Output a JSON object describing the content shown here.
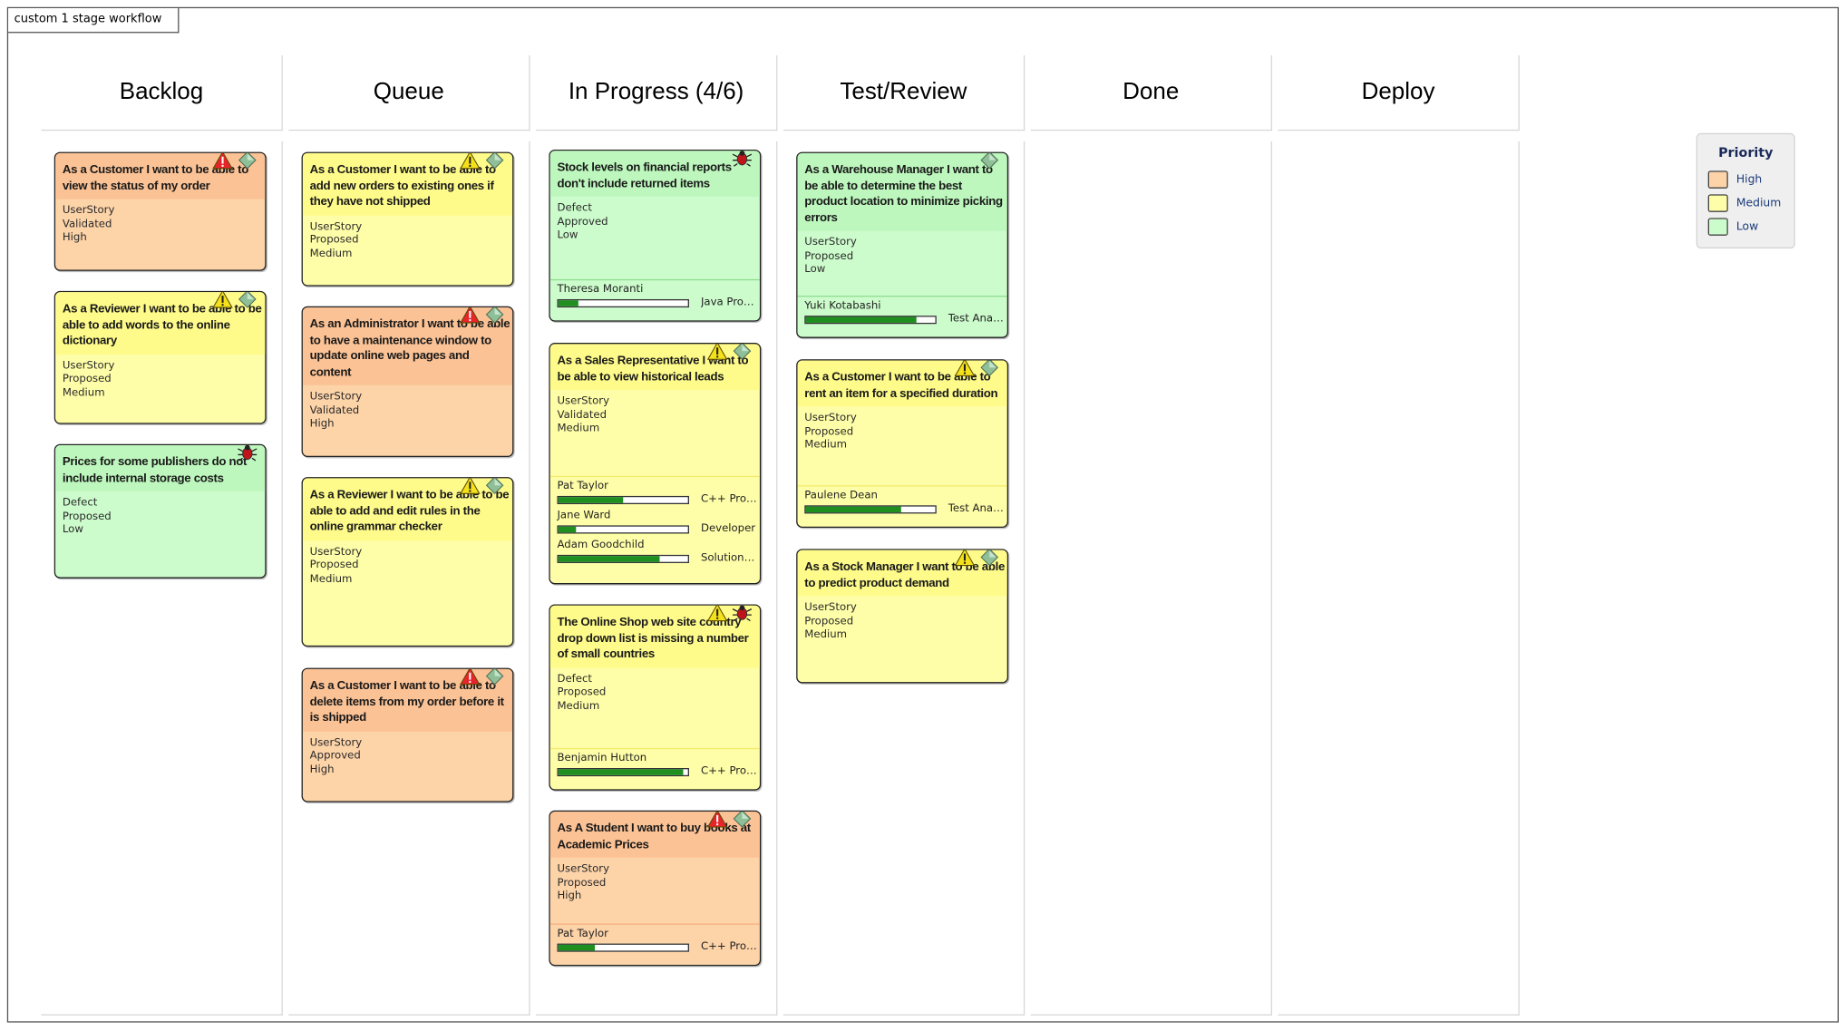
{
  "diagram_title": "custom 1 stage workflow",
  "lanes": [
    "Backlog",
    "Queue",
    "In Progress (4/6)",
    "Test/Review",
    "Done",
    "Deploy"
  ],
  "legend": {
    "title": "Priority",
    "items": [
      {
        "label": "High",
        "color": "#fdd3a8"
      },
      {
        "label": "Medium",
        "color": "#fffea8"
      },
      {
        "label": "Low",
        "color": "#ccfccc"
      }
    ]
  },
  "cards": [
    {
      "lane": 0,
      "title": "As a Customer I want to be able to view the status of my order",
      "type": "UserStory",
      "status": "Validated",
      "priority": "High",
      "icons": [
        "warning-red",
        "diamond"
      ],
      "resources": []
    },
    {
      "lane": 0,
      "title": "As a Reviewer I want to be able to be able to add words to the online dictionary",
      "type": "UserStory",
      "status": "Proposed",
      "priority": "Medium",
      "icons": [
        "warning-yellow",
        "diamond"
      ],
      "resources": []
    },
    {
      "lane": 0,
      "title": "Prices for some publishers do not include internal storage costs",
      "type": "Defect",
      "status": "Proposed",
      "priority": "Low",
      "icons": [
        "bug"
      ],
      "resources": []
    },
    {
      "lane": 1,
      "title": "As a Customer I want to be able to add new orders to existing ones if they have not shipped",
      "type": "UserStory",
      "status": "Proposed",
      "priority": "Medium",
      "icons": [
        "warning-yellow",
        "diamond"
      ],
      "resources": []
    },
    {
      "lane": 1,
      "title": "As an Administrator I want to be able to have a maintenance window to update online web pages and content",
      "type": "UserStory",
      "status": "Validated",
      "priority": "High",
      "icons": [
        "warning-red",
        "diamond"
      ],
      "resources": []
    },
    {
      "lane": 1,
      "title": "As a Reviewer I want to be able to be able to add and edit rules in the online grammar checker",
      "type": "UserStory",
      "status": "Proposed",
      "priority": "Medium",
      "icons": [
        "warning-yellow",
        "diamond"
      ],
      "resources": []
    },
    {
      "lane": 1,
      "title": "As a Customer I want to be able to delete items from my order before it is shipped",
      "type": "UserStory",
      "status": "Approved",
      "priority": "High",
      "icons": [
        "warning-red",
        "diamond"
      ],
      "resources": []
    },
    {
      "lane": 2,
      "title": "Stock levels on financial reports don't include returned items",
      "type": "Defect",
      "status": "Approved",
      "priority": "Low",
      "icons": [
        "bug"
      ],
      "resources": [
        {
          "name": "Theresa Moranti",
          "role": "Java Prog...",
          "progress": 0.15
        }
      ]
    },
    {
      "lane": 2,
      "title": "As a Sales Representative I want to be able to view historical leads",
      "type": "UserStory",
      "status": "Validated",
      "priority": "Medium",
      "icons": [
        "warning-yellow",
        "diamond"
      ],
      "resources": [
        {
          "name": "Pat Taylor",
          "role": "C++ Progr...",
          "progress": 0.5
        },
        {
          "name": "Jane Ward",
          "role": "Developer",
          "progress": 0.14
        },
        {
          "name": "Adam Goodchild",
          "role": "Solution ...",
          "progress": 0.78
        }
      ]
    },
    {
      "lane": 2,
      "title": "The Online Shop web site country drop down list is missing a number of small countries",
      "type": "Defect",
      "status": "Proposed",
      "priority": "Medium",
      "icons": [
        "warning-yellow",
        "bug"
      ],
      "resources": [
        {
          "name": "Benjamin Hutton",
          "role": "C++ Progr...",
          "progress": 0.96
        }
      ]
    },
    {
      "lane": 2,
      "title": "As A Student I want to buy books at Academic Prices",
      "type": "UserStory",
      "status": "Proposed",
      "priority": "High",
      "icons": [
        "warning-red",
        "diamond"
      ],
      "resources": [
        {
          "name": "Pat Taylor",
          "role": "C++ Progr...",
          "progress": 0.28
        }
      ]
    },
    {
      "lane": 3,
      "title": "As a Warehouse Manager I want to be able to determine the best product location to minimize picking errors",
      "type": "UserStory",
      "status": "Proposed",
      "priority": "Low",
      "icons": [
        "diamond"
      ],
      "resources": [
        {
          "name": "Yuki Kotabashi",
          "role": "Test Anal...",
          "progress": 0.85
        }
      ]
    },
    {
      "lane": 3,
      "title": "As a Customer I want to be able to rent an item for a specified duration",
      "type": "UserStory",
      "status": "Proposed",
      "priority": "Medium",
      "icons": [
        "warning-yellow",
        "diamond"
      ],
      "resources": [
        {
          "name": "Paulene Dean",
          "role": "Test Anal...",
          "progress": 0.74
        }
      ]
    },
    {
      "lane": 3,
      "title": "As a Stock Manager I want to be able to predict product demand",
      "type": "UserStory",
      "status": "Proposed",
      "priority": "Medium",
      "icons": [
        "warning-yellow",
        "diamond"
      ],
      "resources": []
    }
  ]
}
